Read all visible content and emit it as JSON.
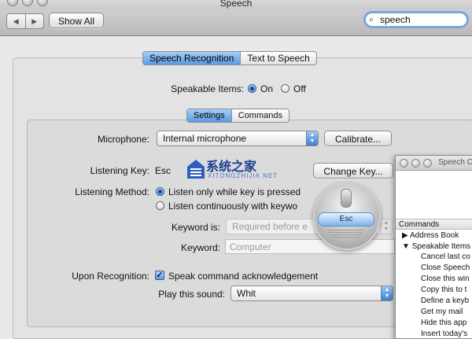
{
  "window": {
    "title": "Speech"
  },
  "toolbar": {
    "back_glyph": "◀",
    "forward_glyph": "▶",
    "show_all_label": "Show All",
    "search_value": "speech",
    "search_icon": "magnifier-icon"
  },
  "tabs": [
    {
      "label": "Speech Recognition",
      "selected": true
    },
    {
      "label": "Text to Speech",
      "selected": false
    }
  ],
  "speakable_items": {
    "label": "Speakable Items:",
    "options": [
      {
        "label": "On",
        "selected": true
      },
      {
        "label": "Off",
        "selected": false
      }
    ]
  },
  "subtabs": [
    {
      "label": "Settings",
      "selected": true
    },
    {
      "label": "Commands",
      "selected": false
    }
  ],
  "settings": {
    "microphone_label": "Microphone:",
    "microphone_value": "Internal microphone",
    "calibrate_label": "Calibrate...",
    "listening_key_label": "Listening Key:",
    "listening_key_value": "Esc",
    "change_key_label": "Change Key...",
    "listening_method_label": "Listening Method:",
    "method_options": [
      {
        "label": "Listen only while key is pressed",
        "selected": true
      },
      {
        "label": "Listen continuously with keywo",
        "selected": false
      }
    ],
    "keyword_is_label": "Keyword is:",
    "keyword_is_value": "Required before e",
    "keyword_label": "Keyword:",
    "keyword_placeholder": "Computer",
    "upon_recognition_label": "Upon Recognition:",
    "speak_ack_label": "Speak command acknowledgement",
    "speak_ack_checked": true,
    "play_sound_label": "Play this sound:",
    "play_sound_value": "Whit"
  },
  "feedback_window": {
    "key_label": "Esc"
  },
  "commands_window": {
    "title": "Speech C",
    "header": "Commands",
    "groups": [
      {
        "label": "Address Book",
        "expanded": false
      },
      {
        "label": "Speakable Items",
        "expanded": true
      }
    ],
    "items": [
      "Cancel last co",
      "Close Speech",
      "Close this win",
      "Copy this to t",
      "Define a keyb",
      "Get my mail",
      "Hide this app",
      "Insert today's"
    ]
  },
  "watermark": {
    "big": "系统之家",
    "small": "XITONGZHIJIA.NET"
  },
  "colors": {
    "accent": "#5a9be2",
    "search_ring": "#7aa6dd",
    "watermark": "#1a3f8f"
  }
}
